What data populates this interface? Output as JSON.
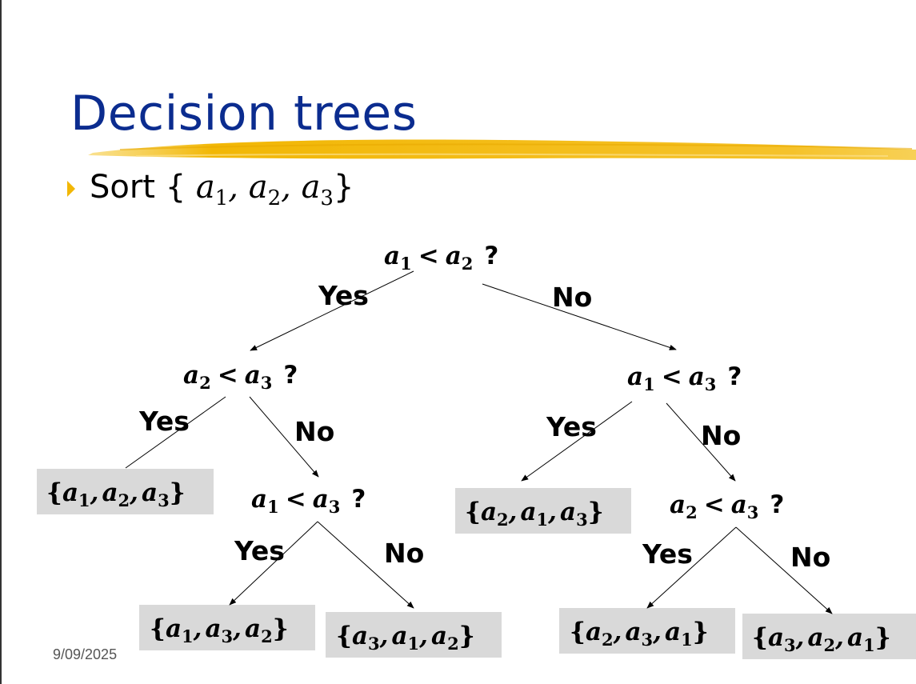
{
  "slide": {
    "title": "Decision trees",
    "bullet": {
      "prefix": "Sort {",
      "items": [
        {
          "base": "a",
          "sub": "1"
        },
        {
          "base": "a",
          "sub": "2"
        },
        {
          "base": "a",
          "sub": "3"
        }
      ],
      "close": "}"
    },
    "footer_date": "9/09/2025",
    "colors": {
      "title": "#0b2c8f",
      "highlight": "#f2b705",
      "bullet": "#f2b705",
      "leaf_box": "#d9d9d9"
    }
  },
  "tree": {
    "nodes": [
      {
        "id": "root",
        "a": "1",
        "b": "2"
      },
      {
        "id": "left",
        "a": "2",
        "b": "3"
      },
      {
        "id": "right",
        "a": "1",
        "b": "3"
      },
      {
        "id": "left-no",
        "a": "1",
        "b": "3"
      },
      {
        "id": "right-no",
        "a": "2",
        "b": "3"
      }
    ],
    "leaves": [
      {
        "id": "leaf-1",
        "perm": [
          "1",
          "2",
          "3"
        ]
      },
      {
        "id": "leaf-2",
        "perm": [
          "2",
          "1",
          "3"
        ]
      },
      {
        "id": "leaf-3",
        "perm": [
          "1",
          "3",
          "2"
        ]
      },
      {
        "id": "leaf-4",
        "perm": [
          "3",
          "1",
          "2"
        ]
      },
      {
        "id": "leaf-5",
        "perm": [
          "2",
          "3",
          "1"
        ]
      },
      {
        "id": "leaf-6",
        "perm": [
          "3",
          "2",
          "1"
        ]
      }
    ],
    "edge_labels": {
      "yes": "Yes",
      "no": "No"
    },
    "symbols": {
      "var": "a",
      "less_than": "<",
      "question": "?",
      "open_brace": "{",
      "close_brace": "}",
      "comma": ","
    }
  }
}
